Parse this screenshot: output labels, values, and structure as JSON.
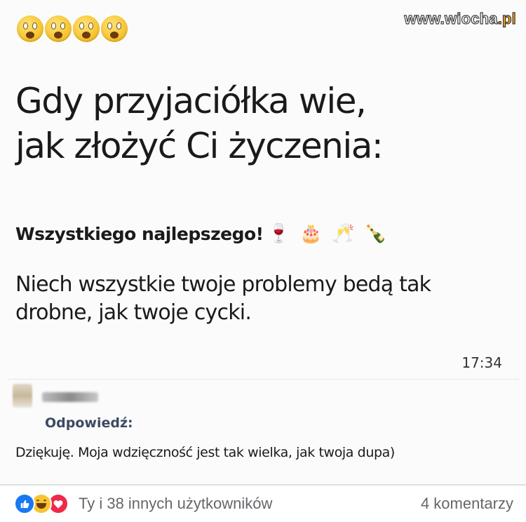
{
  "post": {
    "watermark_main": "www.wiocha",
    "watermark_accent": ".pl",
    "top_emojis": [
      "astonished-face",
      "astonished-face",
      "astonished-face",
      "astonished-face"
    ],
    "headline_line1": "Gdy przyjaciółka wie,",
    "headline_line2": "jak złożyć Ci życzenia:",
    "wish_title": "Wszystkiego najlepszego!",
    "wish_emojis": [
      "🍷",
      "🎂",
      "🥂",
      "🍾"
    ],
    "message": "Niech wszystkie twoje problemy bedą tak drobne, jak twoje cycki.",
    "time": "17:34",
    "reply_label": "Odpowiedź:",
    "reply_text": "Dziękuję. Moja wdzięczność jest tak wielka, jak twoja dupa)"
  },
  "footer": {
    "reactions": [
      "like-icon",
      "haha-icon",
      "love-icon"
    ],
    "reactions_text": "Ty i 38 innych użytkowników",
    "comments": "4 komentarzy"
  },
  "colors": {
    "like": "#1877f2",
    "haha": "#f7c531",
    "love": "#f02849",
    "meta_text": "#65676b",
    "watermark_accent": "#f3a21c"
  }
}
